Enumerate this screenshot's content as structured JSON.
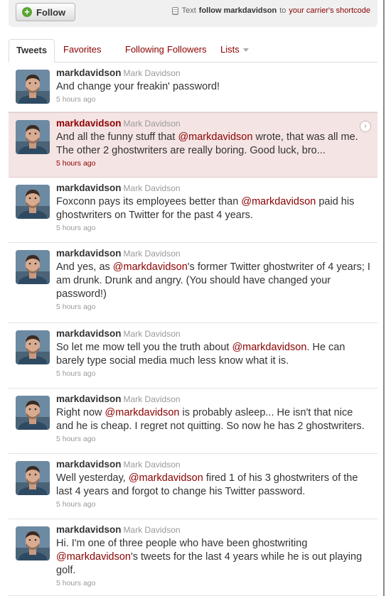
{
  "topbar": {
    "follow_label": "Follow",
    "sms_prefix": "Text",
    "sms_follow_cmd": "follow markdavidson",
    "sms_to": "to",
    "sms_link": "your carrier's shortcode"
  },
  "tabs": [
    {
      "label": "Tweets"
    },
    {
      "label": "Favorites"
    },
    {
      "label": "Following"
    },
    {
      "label": "Followers"
    },
    {
      "label": "Lists"
    }
  ],
  "tweets": [
    {
      "username": "markdavidson",
      "fullname": "Mark Davidson",
      "parts": [
        "And change your freakin' password!"
      ],
      "time": "5 hours ago"
    },
    {
      "username": "markdavidson",
      "fullname": "Mark Davidson",
      "parts": [
        "And all the funny stuff that ",
        "@markdavidson",
        " wrote, that was all me. The other 2 ghostwriters are really boring. Good luck, bro..."
      ],
      "time": "5 hours ago"
    },
    {
      "username": "markdavidson",
      "fullname": "Mark Davidson",
      "parts": [
        "Foxconn pays its employees better than ",
        "@markdavidson",
        " paid his ghostwriters on Twitter for the past 4 years."
      ],
      "time": "5 hours ago"
    },
    {
      "username": "markdavidson",
      "fullname": "Mark Davidson",
      "parts": [
        "And yes, as ",
        "@markdavidson",
        "'s former Twitter ghostwriter of 4 years; I am drunk. Drunk and angry. (You should have changed your password!)"
      ],
      "time": "5 hours ago"
    },
    {
      "username": "markdavidson",
      "fullname": "Mark Davidson",
      "parts": [
        "So let me mow tell you the truth about ",
        "@markdavidson",
        ". He can barely type social media much less know what it is."
      ],
      "time": "5 hours ago"
    },
    {
      "username": "markdavidson",
      "fullname": "Mark Davidson",
      "parts": [
        "Right now ",
        "@markdavidson",
        " is probably asleep... He isn't that nice and he is cheap. I regret not quitting. So now he has 2 ghostwriters."
      ],
      "time": "5 hours ago"
    },
    {
      "username": "markdavidson",
      "fullname": "Mark Davidson",
      "parts": [
        "Well yesterday, ",
        "@markdavidson",
        " fired 1 of his 3 ghostwriters of the last 4 years and forgot to change his Twitter password."
      ],
      "time": "5 hours ago"
    },
    {
      "username": "markdavidson",
      "fullname": "Mark Davidson",
      "parts": [
        "Hi. I'm one of three people who have been ghostwriting ",
        "@markdavidson",
        "'s tweets for the last 4 years while he is out playing golf."
      ],
      "time": "5 hours ago"
    }
  ],
  "colors": {
    "link": "#8b0000",
    "highlight": "#f5e4e4"
  }
}
